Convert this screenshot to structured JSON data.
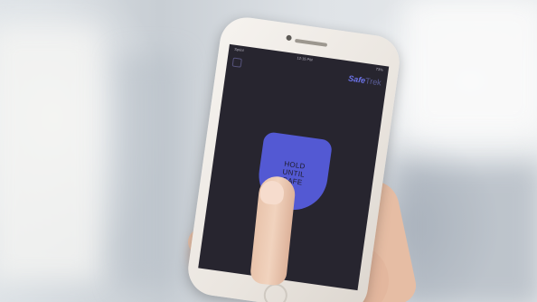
{
  "photo": {
    "subject": "hand holding smartphone with app screen",
    "background": "blurred light outdoor scene"
  },
  "phone_screen": {
    "status_bar": {
      "carrier": "Sprint",
      "time": "12:15 PM",
      "battery": "73%"
    },
    "header": {
      "menu_icon": "hamburger-icon",
      "brand_part1": "Safe",
      "brand_part2": "Trek"
    },
    "hold_button": {
      "line1": "HOLD",
      "line2": "UNTIL",
      "line3": "SAFE"
    }
  },
  "colors": {
    "screen": "#27252f",
    "hold_button": "#5359d3",
    "brand_accent": "#6c73e8",
    "phone_body": "#f1ede8"
  }
}
